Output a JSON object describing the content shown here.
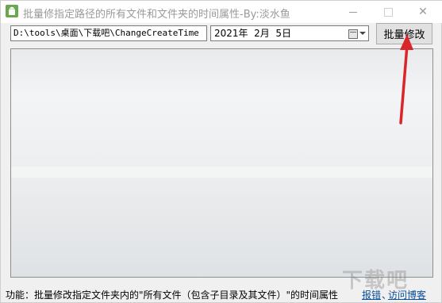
{
  "window": {
    "title": "批量修指定路径的所有文件和文件夹的时间属性-By:淡水鱼",
    "minimize_label": "—",
    "close_label": "✕"
  },
  "toolbar": {
    "path_value": "D:\\tools\\桌面\\下载吧\\ChangeCreateTime",
    "date_value": "2021年  2月  5日",
    "batch_button_label": "批量修改"
  },
  "status": {
    "description": "功能：批量修改指定文件夹内的\"所有文件（包含子目录及其文件）\"的时间属性",
    "report_link": "报错",
    "separator": "、",
    "visit_link": "访问博客"
  },
  "watermark": "下载吧",
  "colors": {
    "annotation_arrow": "#d9262b",
    "link": "#0b4f9a"
  }
}
